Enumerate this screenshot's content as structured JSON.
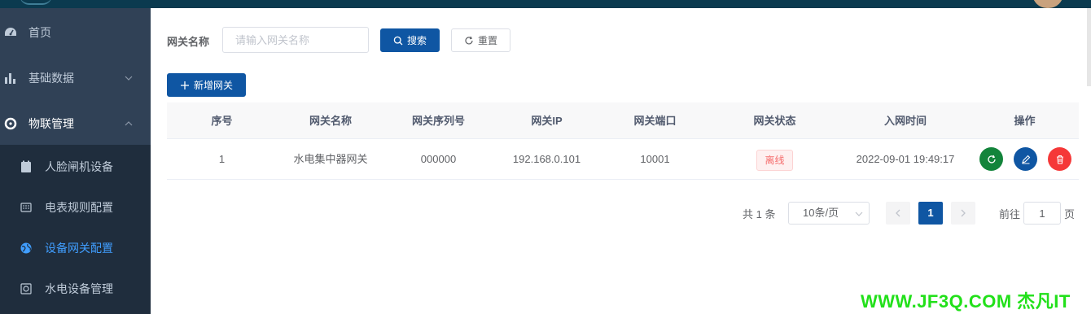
{
  "sidebar": {
    "items": [
      {
        "label": "首页",
        "icon": "dashboard-icon"
      },
      {
        "label": "基础数据",
        "icon": "bar-chart-icon",
        "expanded": false
      },
      {
        "label": "物联管理",
        "icon": "iot-icon",
        "expanded": true
      }
    ],
    "submenu": [
      {
        "label": "人脸闸机设备",
        "icon": "face-gate-icon"
      },
      {
        "label": "电表规则配置",
        "icon": "meter-icon"
      },
      {
        "label": "设备网关配置",
        "icon": "globe-icon",
        "active": true
      },
      {
        "label": "水电设备管理",
        "icon": "device-icon"
      }
    ]
  },
  "search": {
    "label": "网关名称",
    "placeholder": "请输入网关名称",
    "value": "",
    "search_button": "搜索",
    "reset_button": "重置"
  },
  "toolbar": {
    "add_button": "新增网关"
  },
  "table": {
    "columns": [
      "序号",
      "网关名称",
      "网关序列号",
      "网关IP",
      "网关端口",
      "网关状态",
      "入网时间",
      "操作"
    ],
    "rows": [
      {
        "index": "1",
        "name": "水电集中器网关",
        "serial": "000000",
        "ip": "192.168.0.101",
        "port": "10001",
        "status": "离线",
        "joined": "2022-09-01 19:49:17"
      }
    ]
  },
  "pagination": {
    "total": "共 1 条",
    "page_size": "10条/页",
    "current_page": "1",
    "goto_label": "前往",
    "goto_value": "1",
    "page_suffix": "页"
  },
  "watermark": "WWW.JF3Q.COM 杰凡IT",
  "colors": {
    "sidebar_bg": "#304156",
    "submenu_bg": "#1f2d3d",
    "primary": "#0f56a3",
    "active_menu": "#409eff",
    "status_offline": "#f56c6c",
    "op_refresh": "#13843b",
    "op_edit": "#0f56a3",
    "op_delete": "#f53838",
    "watermark": "#22e01a"
  }
}
